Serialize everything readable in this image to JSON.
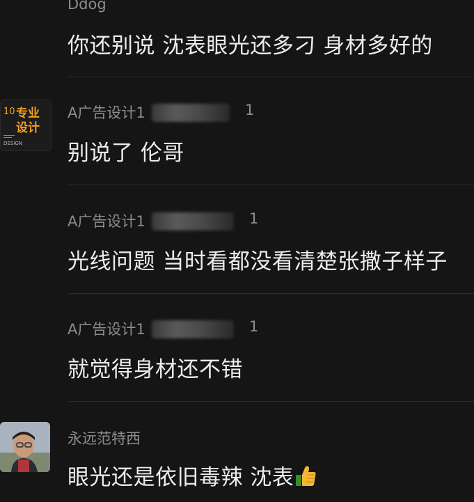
{
  "comments": [
    {
      "username": "Ddog",
      "text": "你还别说 沈表眼光还多刁 身材多好的"
    },
    {
      "username": "A广告设计1",
      "suffix": "1",
      "text": "别说了 伦哥",
      "avatar": {
        "top_text": "专业",
        "bottom_text": "设计",
        "corner_text": "10",
        "footer_text": "DESIGN"
      }
    },
    {
      "username": "A广告设计1",
      "suffix": "1",
      "text": "光线问题 当时看都没看清楚张撒子样子"
    },
    {
      "username": "A广告设计1",
      "suffix": "1",
      "text": "就觉得身材还不错"
    },
    {
      "username": "永远范特西",
      "text": "眼光还是依旧毒辣 沈表",
      "emoji": "thumbs-up-icon"
    }
  ],
  "colors": {
    "background": "#151515",
    "username": "#8d8d8d",
    "text": "#ececec",
    "avatar_accent": "#f0a020"
  }
}
